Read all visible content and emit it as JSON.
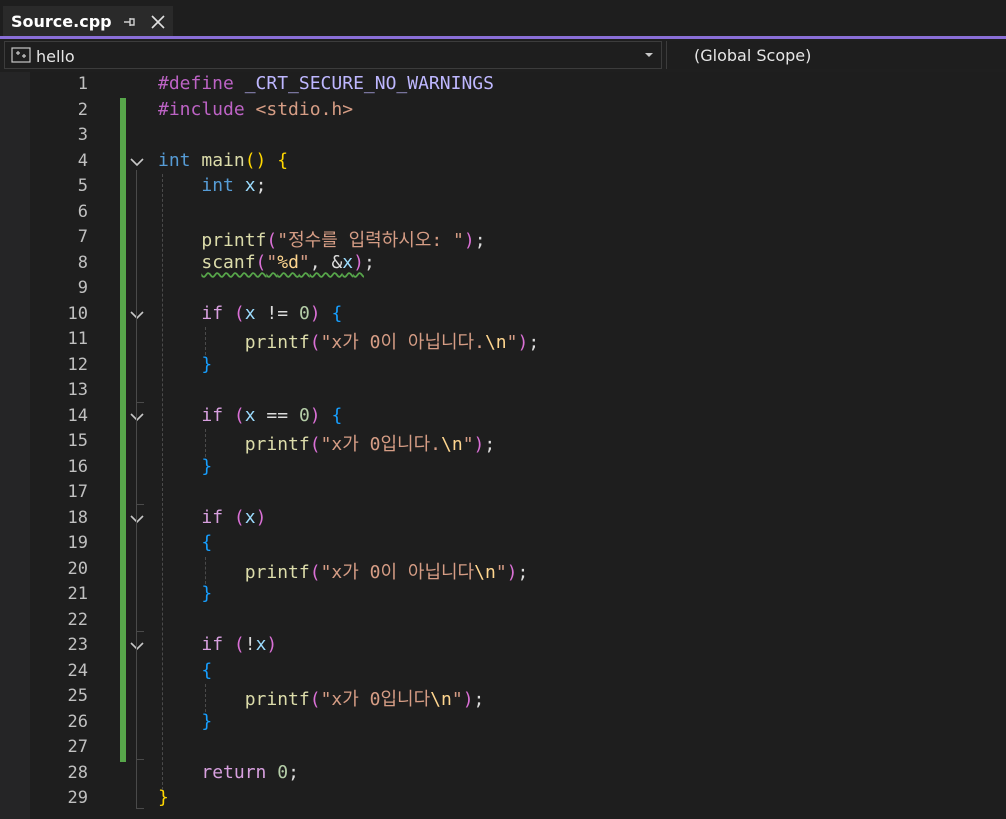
{
  "tab": {
    "title": "Source.cpp"
  },
  "navbar": {
    "project": "hello",
    "scope": "(Global Scope)"
  },
  "colors": {
    "keyword": "#569cd6",
    "control": "#d8a0df",
    "function": "#dcdcaa",
    "string": "#d69d85",
    "escape": "#ffd68f",
    "macro": "#bd63c5",
    "macro_name": "#beb7ff",
    "number": "#b5cea8",
    "variable": "#9cdcfe",
    "text": "#dcdcdc",
    "brace1": "#ffd700",
    "brace2": "#da70d6",
    "brace3": "#179fff",
    "modified_bar": "#57a64a",
    "accent": "#8a6fd8"
  },
  "code_lines": [
    {
      "n": "1",
      "foldable": false,
      "tokens": [
        {
          "t": "#define ",
          "c": "macro"
        },
        {
          "t": "_CRT_SECURE_NO_WARNINGS",
          "c": "macro_name"
        }
      ]
    },
    {
      "n": "2",
      "foldable": false,
      "tokens": [
        {
          "t": "#include ",
          "c": "macro"
        },
        {
          "t": "<stdio.h>",
          "c": "string"
        }
      ]
    },
    {
      "n": "3",
      "foldable": false,
      "tokens": []
    },
    {
      "n": "4",
      "foldable": true,
      "tokens": [
        {
          "t": "int",
          "c": "keyword"
        },
        {
          "t": " ",
          "c": "text"
        },
        {
          "t": "main",
          "c": "function"
        },
        {
          "t": "()",
          "c": "brace1"
        },
        {
          "t": " ",
          "c": "text"
        },
        {
          "t": "{",
          "c": "brace1"
        }
      ]
    },
    {
      "n": "5",
      "foldable": false,
      "tokens": [
        {
          "t": "    ",
          "c": "text"
        },
        {
          "t": "int",
          "c": "keyword"
        },
        {
          "t": " ",
          "c": "text"
        },
        {
          "t": "x",
          "c": "variable"
        },
        {
          "t": ";",
          "c": "text"
        }
      ]
    },
    {
      "n": "6",
      "foldable": false,
      "tokens": []
    },
    {
      "n": "7",
      "foldable": false,
      "tokens": [
        {
          "t": "    ",
          "c": "text"
        },
        {
          "t": "printf",
          "c": "function"
        },
        {
          "t": "(",
          "c": "brace2"
        },
        {
          "t": "\"정수를 입력하시오: \"",
          "c": "string"
        },
        {
          "t": ")",
          "c": "brace2"
        },
        {
          "t": ";",
          "c": "text"
        }
      ]
    },
    {
      "n": "8",
      "foldable": false,
      "tokens": [
        {
          "t": "    ",
          "c": "text"
        },
        {
          "t": "scanf",
          "c": "function",
          "u": true
        },
        {
          "t": "(",
          "c": "brace2",
          "u": true
        },
        {
          "t": "\"",
          "c": "string",
          "u": true
        },
        {
          "t": "%d",
          "c": "escape",
          "u": true
        },
        {
          "t": "\"",
          "c": "string",
          "u": true
        },
        {
          "t": ", &",
          "c": "text",
          "u": true
        },
        {
          "t": "x",
          "c": "variable",
          "u": true
        },
        {
          "t": ")",
          "c": "brace2",
          "u": true
        },
        {
          "t": ";",
          "c": "text"
        }
      ]
    },
    {
      "n": "9",
      "foldable": false,
      "tokens": []
    },
    {
      "n": "10",
      "foldable": true,
      "tokens": [
        {
          "t": "    ",
          "c": "text"
        },
        {
          "t": "if",
          "c": "control"
        },
        {
          "t": " ",
          "c": "text"
        },
        {
          "t": "(",
          "c": "brace2"
        },
        {
          "t": "x",
          "c": "variable"
        },
        {
          "t": " != ",
          "c": "text"
        },
        {
          "t": "0",
          "c": "number"
        },
        {
          "t": ")",
          "c": "brace2"
        },
        {
          "t": " ",
          "c": "text"
        },
        {
          "t": "{",
          "c": "brace3"
        }
      ]
    },
    {
      "n": "11",
      "foldable": false,
      "tokens": [
        {
          "t": "        ",
          "c": "text"
        },
        {
          "t": "printf",
          "c": "function"
        },
        {
          "t": "(",
          "c": "brace2"
        },
        {
          "t": "\"x가 0이 아닙니다.",
          "c": "string"
        },
        {
          "t": "\\n",
          "c": "escape"
        },
        {
          "t": "\"",
          "c": "string"
        },
        {
          "t": ")",
          "c": "brace2"
        },
        {
          "t": ";",
          "c": "text"
        }
      ]
    },
    {
      "n": "12",
      "foldable": false,
      "tokens": [
        {
          "t": "    ",
          "c": "text"
        },
        {
          "t": "}",
          "c": "brace3"
        }
      ]
    },
    {
      "n": "13",
      "foldable": false,
      "tokens": []
    },
    {
      "n": "14",
      "foldable": true,
      "tokens": [
        {
          "t": "    ",
          "c": "text"
        },
        {
          "t": "if",
          "c": "control"
        },
        {
          "t": " ",
          "c": "text"
        },
        {
          "t": "(",
          "c": "brace2"
        },
        {
          "t": "x",
          "c": "variable"
        },
        {
          "t": " == ",
          "c": "text"
        },
        {
          "t": "0",
          "c": "number"
        },
        {
          "t": ")",
          "c": "brace2"
        },
        {
          "t": " ",
          "c": "text"
        },
        {
          "t": "{",
          "c": "brace3"
        }
      ]
    },
    {
      "n": "15",
      "foldable": false,
      "tokens": [
        {
          "t": "        ",
          "c": "text"
        },
        {
          "t": "printf",
          "c": "function"
        },
        {
          "t": "(",
          "c": "brace2"
        },
        {
          "t": "\"x가 0입니다.",
          "c": "string"
        },
        {
          "t": "\\n",
          "c": "escape"
        },
        {
          "t": "\"",
          "c": "string"
        },
        {
          "t": ")",
          "c": "brace2"
        },
        {
          "t": ";",
          "c": "text"
        }
      ]
    },
    {
      "n": "16",
      "foldable": false,
      "tokens": [
        {
          "t": "    ",
          "c": "text"
        },
        {
          "t": "}",
          "c": "brace3"
        }
      ]
    },
    {
      "n": "17",
      "foldable": false,
      "tokens": []
    },
    {
      "n": "18",
      "foldable": true,
      "tokens": [
        {
          "t": "    ",
          "c": "text"
        },
        {
          "t": "if",
          "c": "control"
        },
        {
          "t": " ",
          "c": "text"
        },
        {
          "t": "(",
          "c": "brace2"
        },
        {
          "t": "x",
          "c": "variable"
        },
        {
          "t": ")",
          "c": "brace2"
        }
      ]
    },
    {
      "n": "19",
      "foldable": false,
      "tokens": [
        {
          "t": "    ",
          "c": "text"
        },
        {
          "t": "{",
          "c": "brace3"
        }
      ]
    },
    {
      "n": "20",
      "foldable": false,
      "tokens": [
        {
          "t": "        ",
          "c": "text"
        },
        {
          "t": "printf",
          "c": "function"
        },
        {
          "t": "(",
          "c": "brace2"
        },
        {
          "t": "\"x가 0이 아닙니다",
          "c": "string"
        },
        {
          "t": "\\n",
          "c": "escape"
        },
        {
          "t": "\"",
          "c": "string"
        },
        {
          "t": ")",
          "c": "brace2"
        },
        {
          "t": ";",
          "c": "text"
        }
      ]
    },
    {
      "n": "21",
      "foldable": false,
      "tokens": [
        {
          "t": "    ",
          "c": "text"
        },
        {
          "t": "}",
          "c": "brace3"
        }
      ]
    },
    {
      "n": "22",
      "foldable": false,
      "tokens": []
    },
    {
      "n": "23",
      "foldable": true,
      "tokens": [
        {
          "t": "    ",
          "c": "text"
        },
        {
          "t": "if",
          "c": "control"
        },
        {
          "t": " ",
          "c": "text"
        },
        {
          "t": "(",
          "c": "brace2"
        },
        {
          "t": "!",
          "c": "text"
        },
        {
          "t": "x",
          "c": "variable"
        },
        {
          "t": ")",
          "c": "brace2"
        }
      ]
    },
    {
      "n": "24",
      "foldable": false,
      "tokens": [
        {
          "t": "    ",
          "c": "text"
        },
        {
          "t": "{",
          "c": "brace3"
        }
      ]
    },
    {
      "n": "25",
      "foldable": false,
      "tokens": [
        {
          "t": "        ",
          "c": "text"
        },
        {
          "t": "printf",
          "c": "function"
        },
        {
          "t": "(",
          "c": "brace2"
        },
        {
          "t": "\"x가 0입니다",
          "c": "string"
        },
        {
          "t": "\\n",
          "c": "escape"
        },
        {
          "t": "\"",
          "c": "string"
        },
        {
          "t": ")",
          "c": "brace2"
        },
        {
          "t": ";",
          "c": "text"
        }
      ]
    },
    {
      "n": "26",
      "foldable": false,
      "tokens": [
        {
          "t": "    ",
          "c": "text"
        },
        {
          "t": "}",
          "c": "brace3"
        }
      ]
    },
    {
      "n": "27",
      "foldable": false,
      "tokens": []
    },
    {
      "n": "28",
      "foldable": false,
      "tokens": [
        {
          "t": "    ",
          "c": "text"
        },
        {
          "t": "return",
          "c": "control"
        },
        {
          "t": " ",
          "c": "text"
        },
        {
          "t": "0",
          "c": "number"
        },
        {
          "t": ";",
          "c": "text"
        }
      ]
    },
    {
      "n": "29",
      "foldable": false,
      "tokens": [
        {
          "t": "}",
          "c": "brace1"
        }
      ]
    }
  ]
}
